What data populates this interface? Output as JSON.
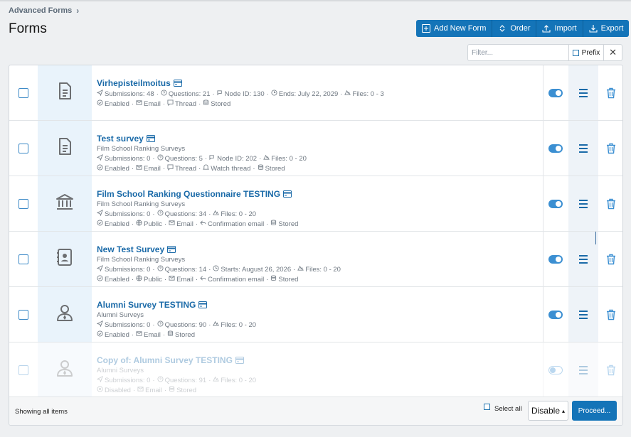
{
  "breadcrumb": {
    "label": "Advanced Forms",
    "chevron": "chevron-right-icon"
  },
  "page_title": "Forms",
  "toolbar": {
    "add_new_form": "Add New Form",
    "order": "Order",
    "import": "Import",
    "export": "Export"
  },
  "filter": {
    "placeholder": "Filter...",
    "prefix_label": "Prefix",
    "clear": "✕"
  },
  "rows": [
    {
      "title": "Virhepisteilmoitus",
      "subtitle": "",
      "submissions": "Submissions: 48",
      "questions": "Questions: 21",
      "node": "Node ID: 130",
      "date": "Ends: July 22, 2029",
      "files": "Files: 0 - 3",
      "flags": [
        "Enabled",
        "Email",
        "Thread",
        "Stored"
      ],
      "icon": "document-icon",
      "enabled": true
    },
    {
      "title": "Test survey",
      "subtitle": "Film School Ranking Surveys",
      "submissions": "Submissions: 0",
      "questions": "Questions: 5",
      "node": "Node ID: 202",
      "date": "",
      "files": "Files: 0 - 20",
      "flags": [
        "Enabled",
        "Email",
        "Thread",
        "Watch thread",
        "Stored"
      ],
      "icon": "document-icon",
      "enabled": true
    },
    {
      "title": "Film School Ranking Questionnaire TESTING",
      "subtitle": "Film School Ranking Surveys",
      "submissions": "Submissions: 0",
      "questions": "Questions: 34",
      "node": "",
      "date": "",
      "files": "Files: 0 - 20",
      "flags": [
        "Enabled",
        "Public",
        "Email",
        "Confirmation email",
        "Stored"
      ],
      "icon": "institution-icon",
      "enabled": true
    },
    {
      "title": "New Test Survey",
      "subtitle": "Film School Ranking Surveys",
      "submissions": "Submissions: 0",
      "questions": "Questions: 14",
      "node": "",
      "date": "Starts: August 26, 2026",
      "files": "Files: 0 - 20",
      "flags": [
        "Enabled",
        "Public",
        "Email",
        "Confirmation email",
        "Stored"
      ],
      "icon": "address-book-icon",
      "enabled": true
    },
    {
      "title": "Alumni Survey TESTING",
      "subtitle": "Alumni Surveys",
      "submissions": "Submissions: 0",
      "questions": "Questions: 90",
      "node": "",
      "date": "",
      "files": "Files: 0 - 20",
      "flags": [
        "Enabled",
        "Email",
        "Stored"
      ],
      "icon": "user-tie-icon",
      "enabled": true
    },
    {
      "title": "Copy of: Alumni Survey TESTING",
      "subtitle": "Alumni Surveys",
      "submissions": "Submissions: 0",
      "questions": "Questions: 91",
      "node": "",
      "date": "",
      "files": "Files: 0 - 20",
      "flags": [
        "Disabled",
        "Email",
        "Stored"
      ],
      "icon": "user-tie-icon",
      "enabled": false
    }
  ],
  "footer": {
    "count": "Showing all items",
    "select_all": "Select all",
    "action_value": "Disable",
    "proceed": "Proceed..."
  },
  "colors": {
    "accent": "#1474b8",
    "link": "#1a6aa8",
    "icon_bg": "#e9f3fb"
  }
}
